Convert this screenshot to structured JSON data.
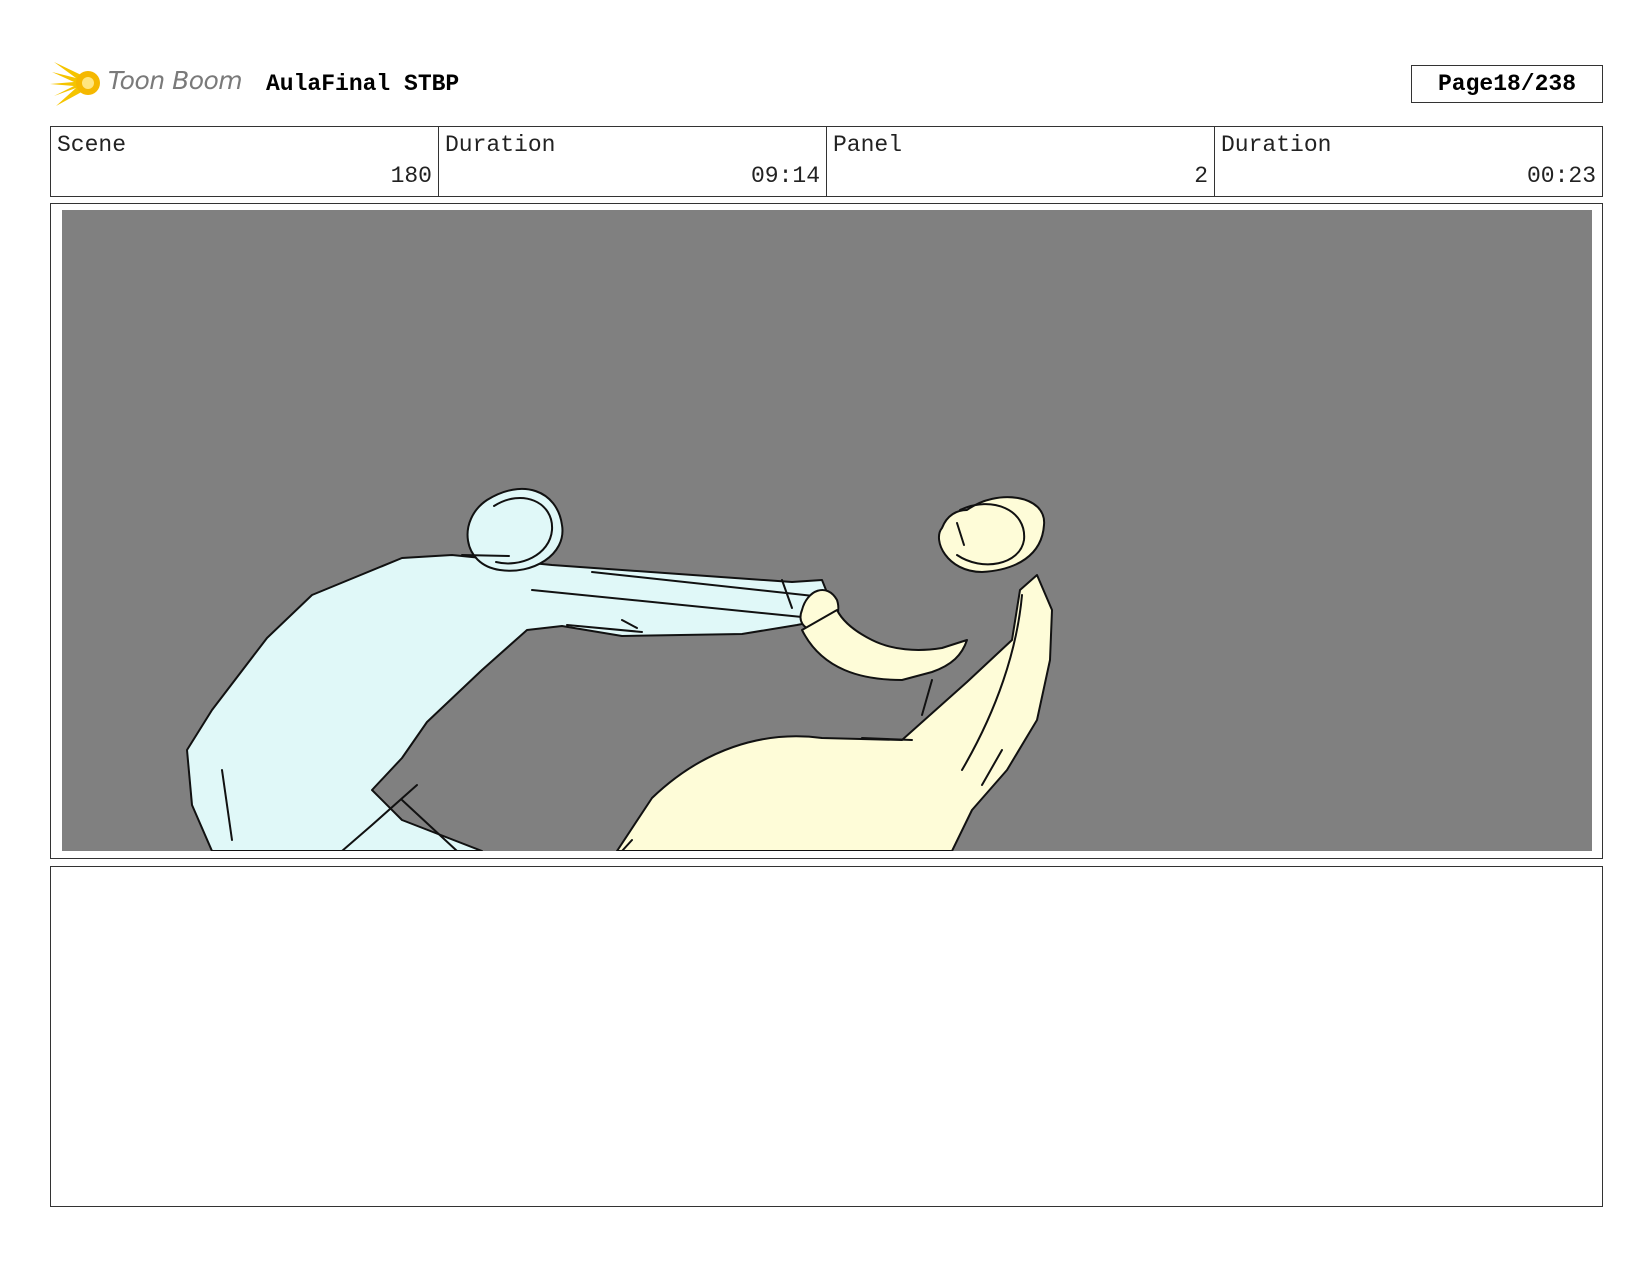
{
  "header": {
    "logo_text": "Toon Boom",
    "project_title": "AulaFinal STBP",
    "page_label": "Page",
    "page_number": "18/238"
  },
  "info": [
    {
      "label": "Scene",
      "value": "180"
    },
    {
      "label": "Duration",
      "value": "09:14"
    },
    {
      "label": "Panel",
      "value": "2"
    },
    {
      "label": "Duration",
      "value": "00:23"
    }
  ],
  "panel": {
    "background_color": "#808080",
    "figure_left_color": "#e0f8f8",
    "figure_right_color": "#fefcd8"
  },
  "notes": {
    "text": ""
  }
}
